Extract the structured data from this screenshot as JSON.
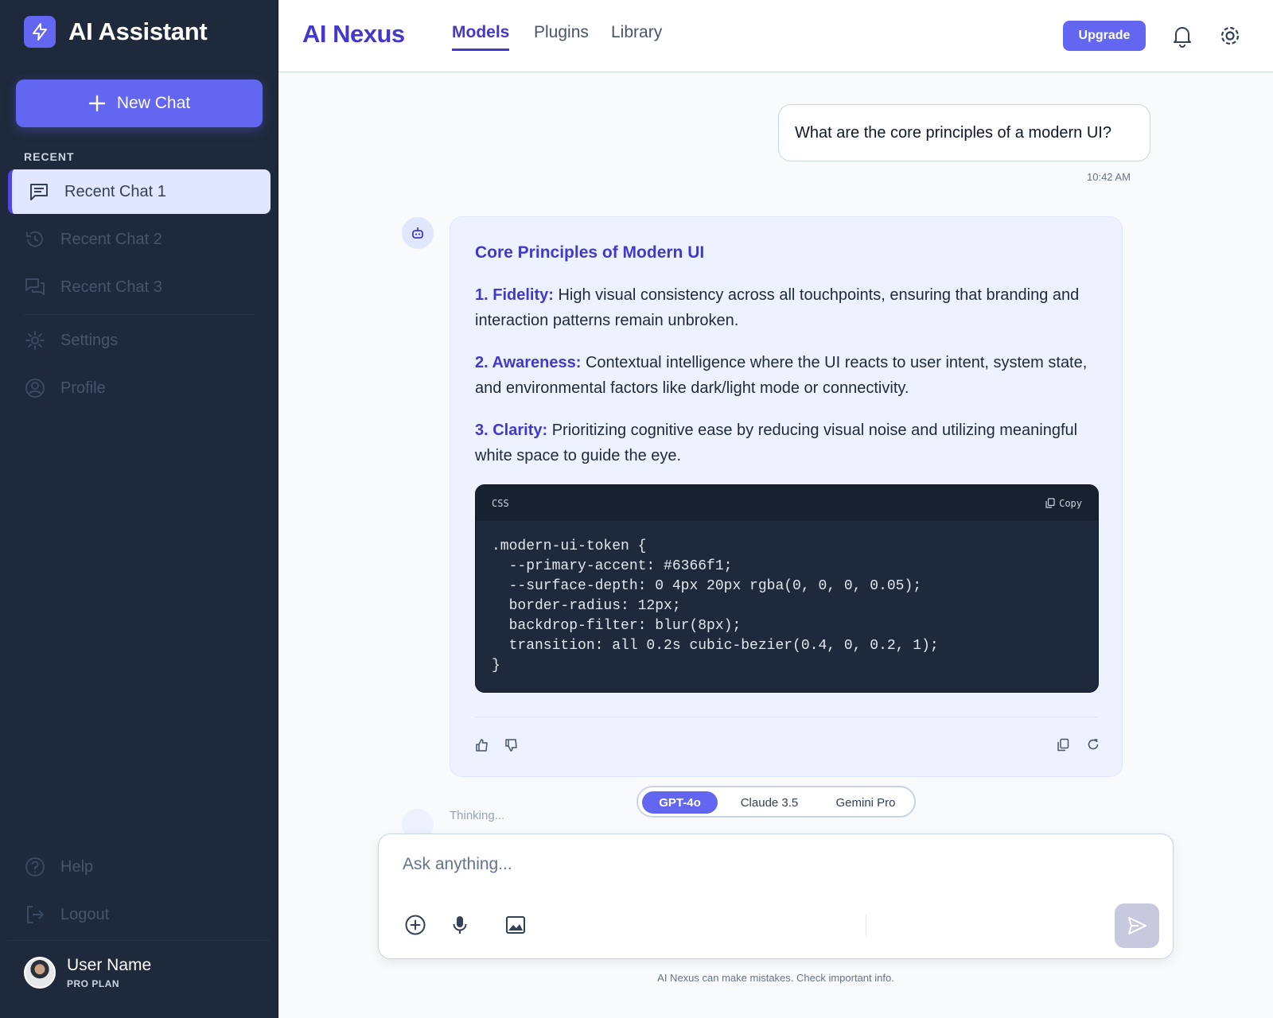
{
  "sidebar": {
    "brand_title": "AI Assistant",
    "new_chat_label": "New Chat",
    "section_label": "RECENT",
    "recent": [
      {
        "label": "Recent Chat 1",
        "icon": "message-square-icon",
        "active": true
      },
      {
        "label": "Recent Chat 2",
        "icon": "history-icon",
        "active": false
      },
      {
        "label": "Recent Chat 3",
        "icon": "chat-bubbles-icon",
        "active": false
      }
    ],
    "settings_label": "Settings",
    "profile_label": "Profile",
    "help_label": "Help",
    "logout_label": "Logout",
    "user": {
      "name": "User Name",
      "plan": "PRO PLAN"
    }
  },
  "header": {
    "app_name": "AI Nexus",
    "tabs": [
      {
        "label": "Models",
        "active": true
      },
      {
        "label": "Plugins",
        "active": false
      },
      {
        "label": "Library",
        "active": false
      }
    ],
    "upgrade_label": "Upgrade"
  },
  "conversation": {
    "user_message": "What are the core principles of a modern UI?",
    "user_time": "10:42 AM",
    "bot": {
      "title": "Core Principles of Modern UI",
      "principles": [
        {
          "label": "1. Fidelity:",
          "text": "High visual consistency across all touchpoints, ensuring that branding and interaction patterns remain unbroken."
        },
        {
          "label": "2. Awareness:",
          "text": "Contextual intelligence where the UI reacts to user intent, system state, and environmental factors like dark/light mode or connectivity."
        },
        {
          "label": "3. Clarity:",
          "text": "Prioritizing cognitive ease by reducing visual noise and utilizing meaningful white space to guide the eye."
        }
      ],
      "code": {
        "language": "CSS",
        "copy_label": "Copy",
        "lines": [
          ".modern-ui-token {",
          "  --primary-accent: #6366f1;",
          "  --surface-depth: 0 4px 20px rgba(0, 0, 0, 0.05);",
          "  border-radius: 12px;",
          "  backdrop-filter: blur(8px);",
          "  transition: all 0.2s cubic-bezier(0.4, 0, 0.2, 1);",
          "}"
        ]
      }
    },
    "thinking_label": "Thinking..."
  },
  "models": [
    {
      "label": "GPT-4o",
      "active": true
    },
    {
      "label": "Claude 3.5",
      "active": false
    },
    {
      "label": "Gemini Pro",
      "active": false
    }
  ],
  "composer": {
    "placeholder": "Ask anything...",
    "value": ""
  },
  "disclaimer": "AI Nexus can make mistakes. Check important info.",
  "colors": {
    "accent": "#6366f1",
    "accent_dark": "#4338ca",
    "sidebar_bg": "#1e293b",
    "code_bg": "#1e293b"
  }
}
